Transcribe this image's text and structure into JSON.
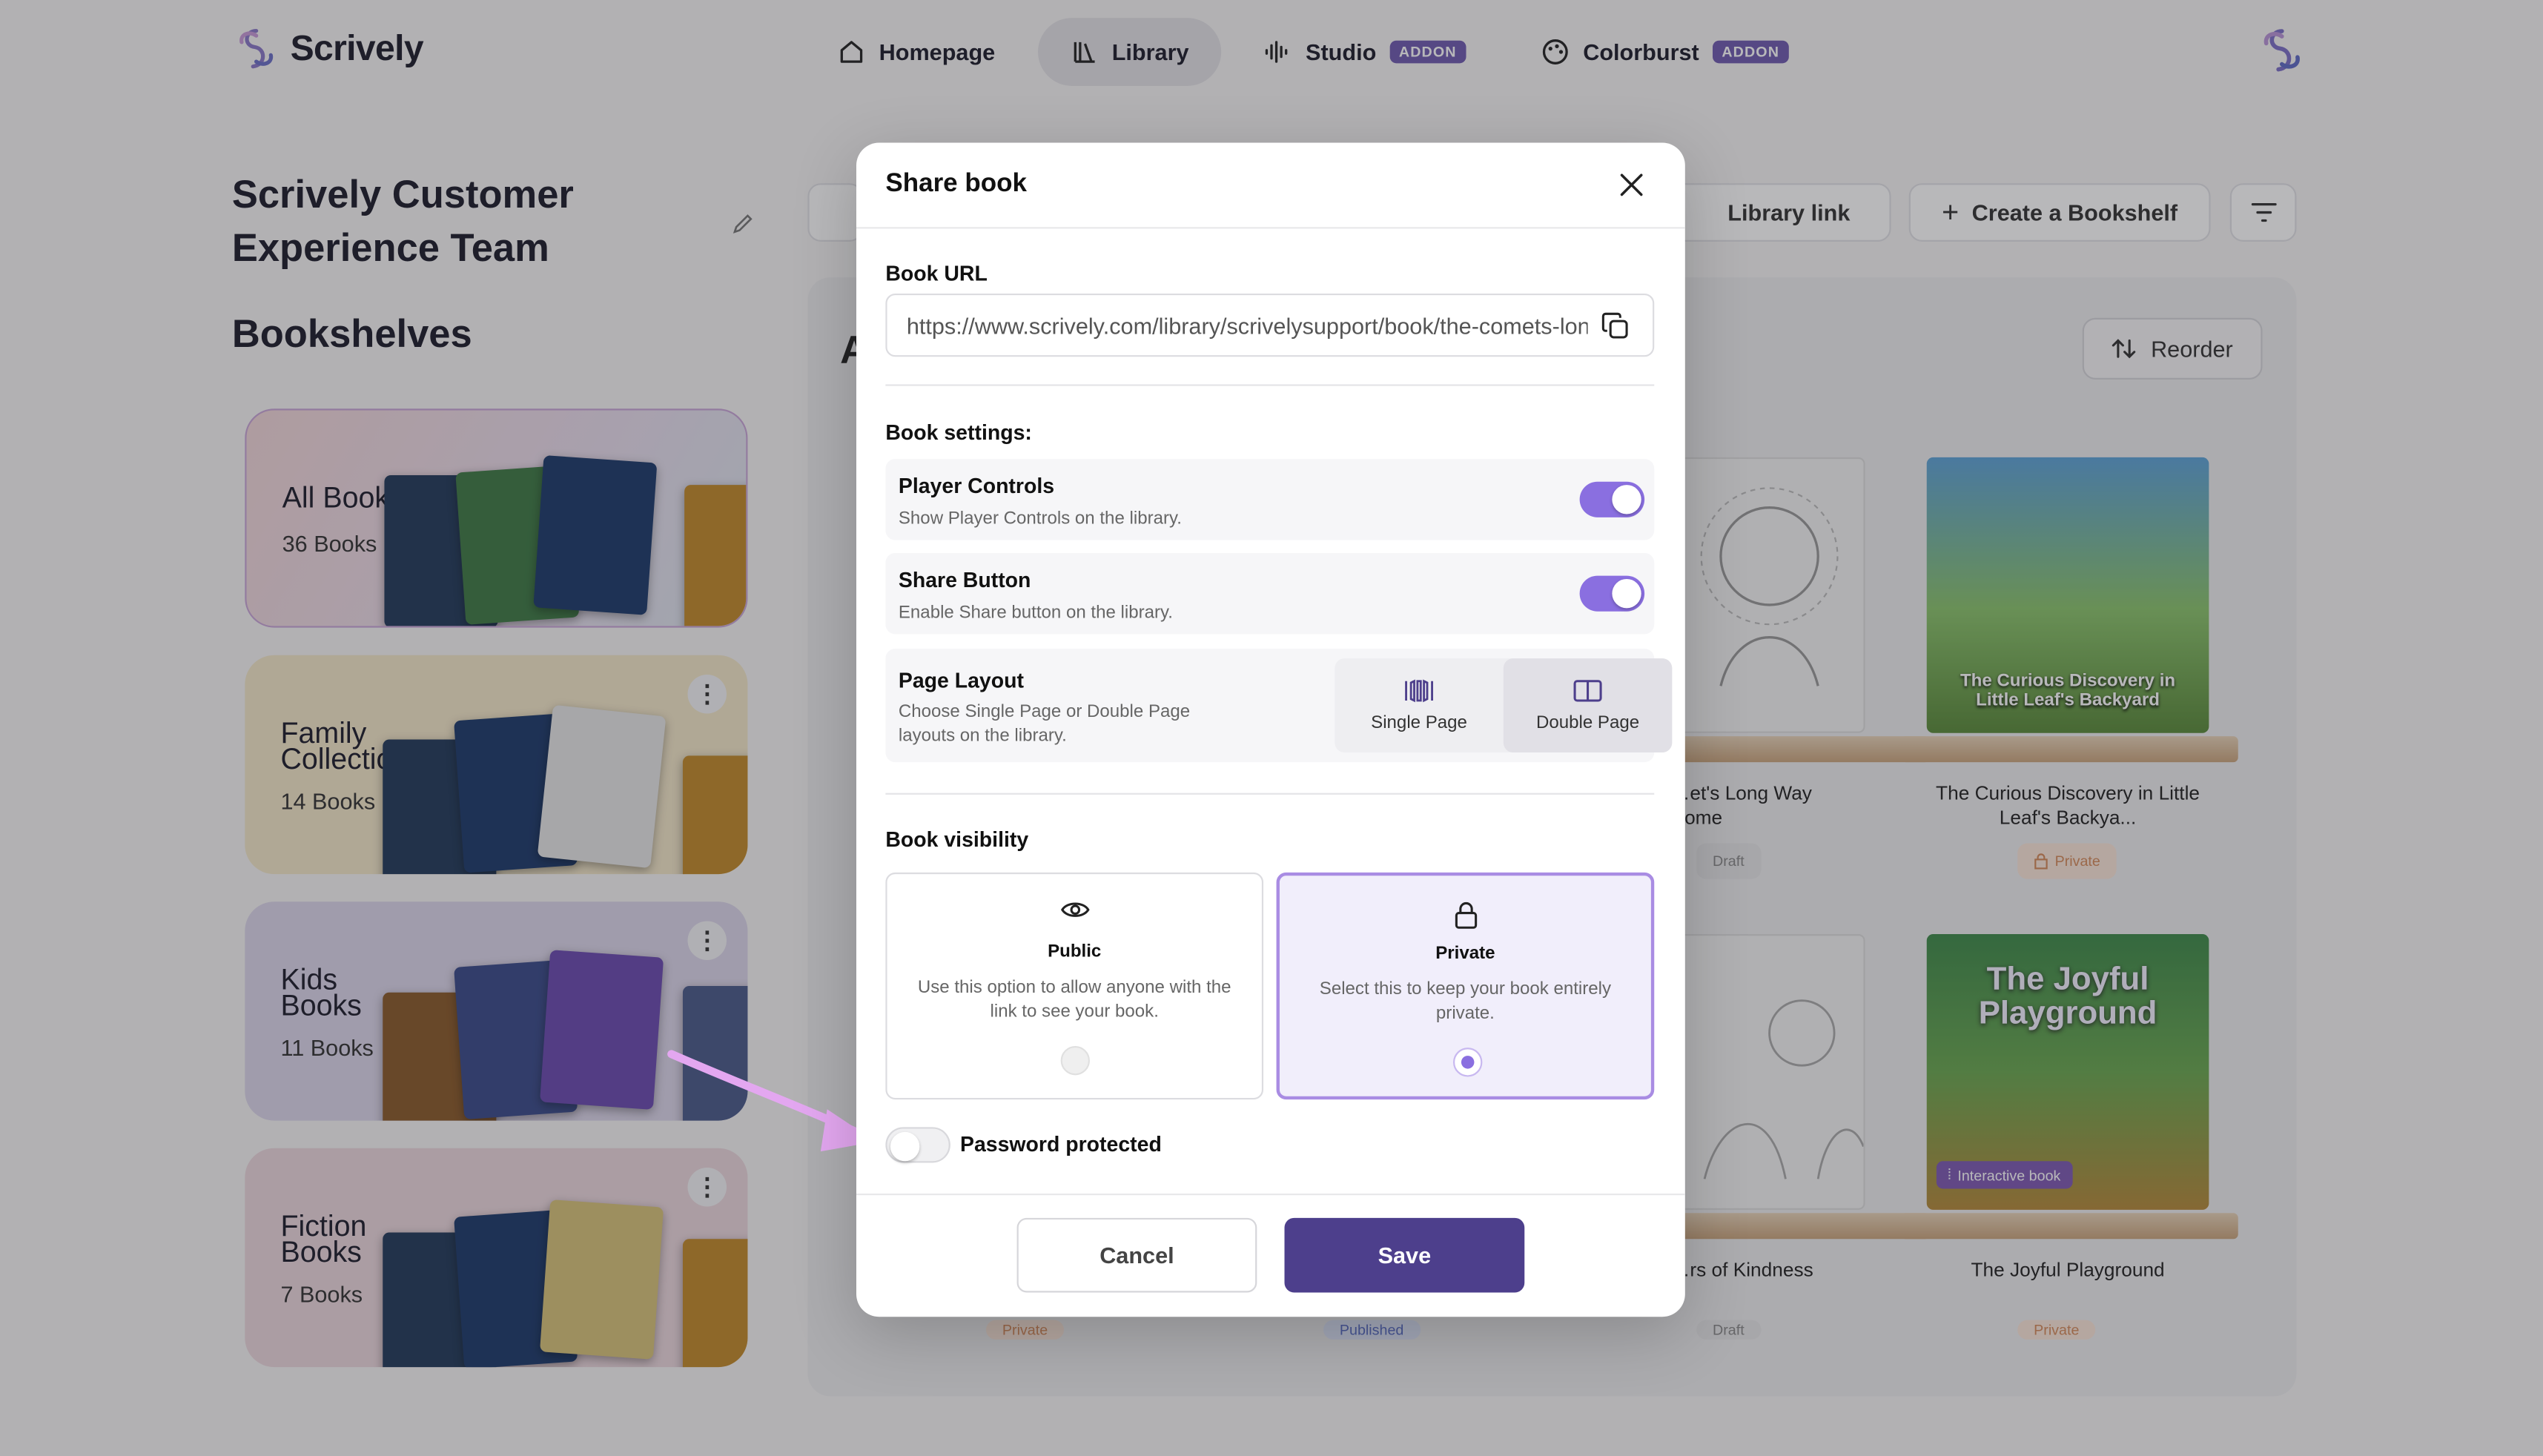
{
  "app": {
    "brand": "Scrively",
    "nav": [
      {
        "label": "Homepage",
        "icon": "home-icon"
      },
      {
        "label": "Library",
        "icon": "library-icon",
        "active": true
      },
      {
        "label": "Studio",
        "icon": "audio-wave-icon",
        "badge": "ADDON"
      },
      {
        "label": "Colorburst",
        "icon": "palette-icon",
        "badge": "ADDON"
      }
    ]
  },
  "sidebar": {
    "team_name": "Scrively Customer Experience Team",
    "bookshelves_title": "Bookshelves",
    "shelves": [
      {
        "title": "All Books",
        "count": "36 Books"
      },
      {
        "title": "Family Collection",
        "count": "14 Books"
      },
      {
        "title": "Kids Books",
        "count": "11 Books"
      },
      {
        "title": "Fiction Books",
        "count": "7 Books"
      }
    ]
  },
  "toolbar": {
    "library_link": "Library link",
    "create_bookshelf": "Create a Bookshelf",
    "reorder": "Reorder",
    "section_initial": "A"
  },
  "books": [
    {
      "title": "…et's Long Way Home",
      "status": "Draft"
    },
    {
      "title": "The Curious Discovery in Little Leaf's Backya...",
      "status": "Private",
      "cover_text": "The Curious Discovery in Little Leaf's Backyard"
    },
    {
      "title": "…rs of Kindness",
      "status": "Draft"
    },
    {
      "title": "The Joyful Playground",
      "status": "Private",
      "cover_text": "The Joyful Playground",
      "cover_badge": "Interactive book"
    }
  ],
  "bottom_badges": [
    "Private",
    "Published",
    "Draft",
    "Private"
  ],
  "modal": {
    "title": "Share book",
    "book_url_label": "Book URL",
    "book_url": "https://www.scrively.com/library/scrivelysupport/book/the-comets-long-way-home",
    "settings_label": "Book settings:",
    "player_controls": {
      "title": "Player Controls",
      "desc": "Show Player Controls on the library.",
      "enabled": true
    },
    "share_button": {
      "title": "Share Button",
      "desc": "Enable Share button on the library.",
      "enabled": true
    },
    "page_layout": {
      "title": "Page Layout",
      "desc": "Choose Single Page or Double Page layouts on the library.",
      "options": [
        "Single Page",
        "Double Page"
      ],
      "selected": "Double Page"
    },
    "visibility_label": "Book visibility",
    "visibility": [
      {
        "title": "Public",
        "desc": "Use this option to allow anyone with the link to see your book.",
        "selected": false
      },
      {
        "title": "Private",
        "desc": "Select this to keep your book entirely private.",
        "selected": true
      }
    ],
    "password_protected": {
      "label": "Password protected",
      "enabled": false
    },
    "cancel_label": "Cancel",
    "save_label": "Save"
  },
  "colors": {
    "accent": "#8a6fe0",
    "primary_button": "#4d3f8c",
    "addon_badge": "#6f5ab0"
  }
}
